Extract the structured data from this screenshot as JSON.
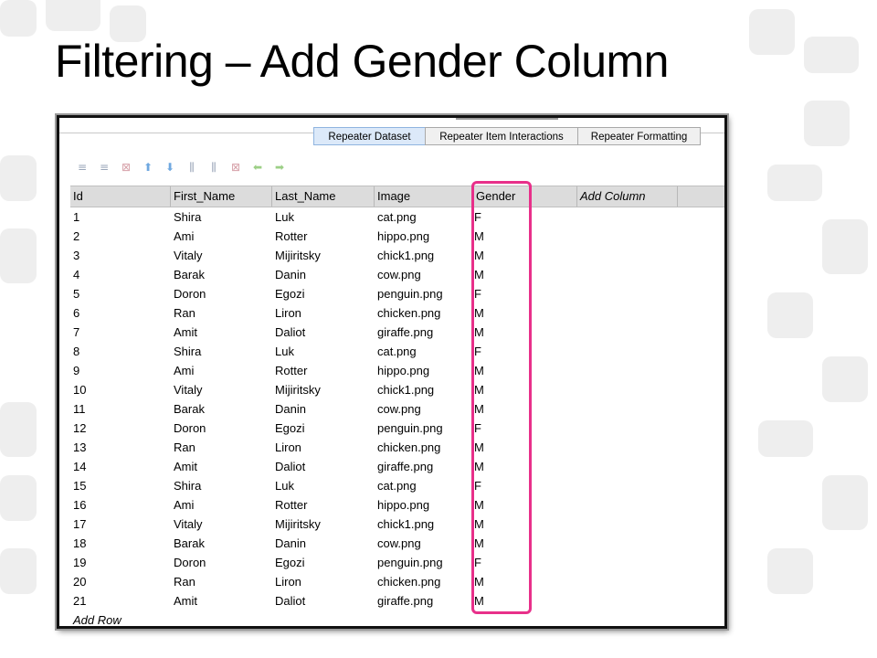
{
  "slide": {
    "title": "Filtering – Add Gender Column"
  },
  "tabs": [
    "Repeater Dataset",
    "Repeater Item Interactions",
    "Repeater Formatting"
  ],
  "toolbar_icons": [
    "insert-row-above-icon",
    "insert-row-below-icon",
    "delete-row-icon",
    "move-up-icon",
    "move-down-icon",
    "insert-column-left-icon",
    "insert-column-right-icon",
    "delete-column-icon",
    "move-left-icon",
    "move-right-icon"
  ],
  "grid": {
    "headers": [
      "Id",
      "First_Name",
      "Last_Name",
      "Image",
      "Gender",
      "Add Column"
    ],
    "rows": [
      [
        "1",
        "Shira",
        "Luk",
        "cat.png",
        "F"
      ],
      [
        "2",
        "Ami",
        "Rotter",
        "hippo.png",
        "M"
      ],
      [
        "3",
        "Vitaly",
        "Mijiritsky",
        "chick1.png",
        "M"
      ],
      [
        "4",
        "Barak",
        "Danin",
        "cow.png",
        "M"
      ],
      [
        "5",
        "Doron",
        "Egozi",
        "penguin.png",
        "F"
      ],
      [
        "6",
        "Ran",
        "Liron",
        "chicken.png",
        "M"
      ],
      [
        "7",
        "Amit",
        "Daliot",
        "giraffe.png",
        "M"
      ],
      [
        "8",
        "Shira",
        "Luk",
        "cat.png",
        "F"
      ],
      [
        "9",
        "Ami",
        "Rotter",
        "hippo.png",
        "M"
      ],
      [
        "10",
        "Vitaly",
        "Mijiritsky",
        "chick1.png",
        "M"
      ],
      [
        "11",
        "Barak",
        "Danin",
        "cow.png",
        "M"
      ],
      [
        "12",
        "Doron",
        "Egozi",
        "penguin.png",
        "F"
      ],
      [
        "13",
        "Ran",
        "Liron",
        "chicken.png",
        "M"
      ],
      [
        "14",
        "Amit",
        "Daliot",
        "giraffe.png",
        "M"
      ],
      [
        "15",
        "Shira",
        "Luk",
        "cat.png",
        "F"
      ],
      [
        "16",
        "Ami",
        "Rotter",
        "hippo.png",
        "M"
      ],
      [
        "17",
        "Vitaly",
        "Mijiritsky",
        "chick1.png",
        "M"
      ],
      [
        "18",
        "Barak",
        "Danin",
        "cow.png",
        "M"
      ],
      [
        "19",
        "Doron",
        "Egozi",
        "penguin.png",
        "F"
      ],
      [
        "20",
        "Ran",
        "Liron",
        "chicken.png",
        "M"
      ],
      [
        "21",
        "Amit",
        "Daliot",
        "giraffe.png",
        "M"
      ]
    ],
    "add_row_label": "Add Row"
  },
  "colors": {
    "highlight": "#e8308a",
    "active_tab": "#dce9f9"
  }
}
